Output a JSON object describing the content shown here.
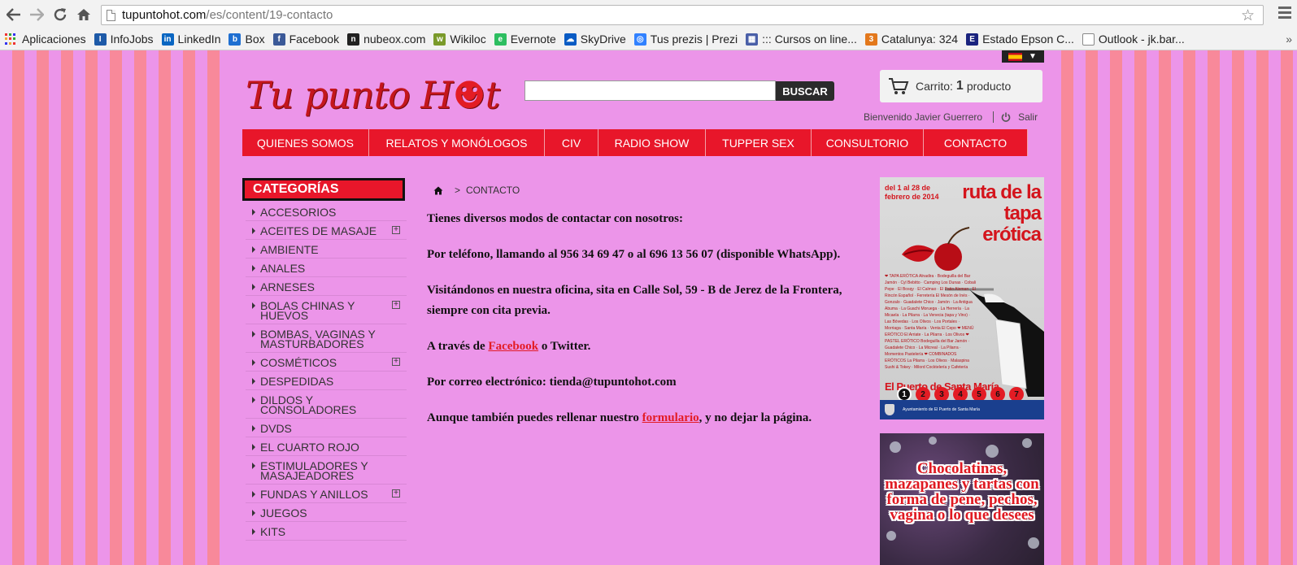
{
  "browser": {
    "url_host": "tupuntohot.com",
    "url_path": "/es/content/19-contacto",
    "bookmarks": [
      {
        "label": "Aplicaciones",
        "icon": "apps-icon"
      },
      {
        "label": "InfoJobs",
        "icon": "infojobs-icon",
        "color": "#1e5aa8",
        "glyph": "I"
      },
      {
        "label": "LinkedIn",
        "icon": "linkedin-icon",
        "color": "#0a66c2",
        "glyph": "in"
      },
      {
        "label": "Box",
        "icon": "box-icon",
        "color": "#1f6fd1",
        "glyph": "b"
      },
      {
        "label": "Facebook",
        "icon": "facebook-icon",
        "color": "#3b5998",
        "glyph": "f"
      },
      {
        "label": "nubeox.com",
        "icon": "nubeox-icon",
        "color": "#222222",
        "glyph": "n"
      },
      {
        "label": "Wikiloc",
        "icon": "wikiloc-icon",
        "color": "#7a9a2a",
        "glyph": "w"
      },
      {
        "label": "Evernote",
        "icon": "evernote-icon",
        "color": "#2dbe60",
        "glyph": "e"
      },
      {
        "label": "SkyDrive",
        "icon": "skydrive-icon",
        "color": "#0a5bc4",
        "glyph": "☁"
      },
      {
        "label": "Tus prezis | Prezi",
        "icon": "prezi-icon",
        "color": "#3181ff",
        "glyph": "◎"
      },
      {
        "label": "::: Cursos on line...",
        "icon": "cursos-icon",
        "color": "#4a5fa8",
        "glyph": "▦"
      },
      {
        "label": "Catalunya: 324",
        "icon": "catalunya-icon",
        "color": "#e3781c",
        "glyph": "3"
      },
      {
        "label": "Estado  Epson C...",
        "icon": "epson-icon",
        "color": "#1a237e",
        "glyph": "E"
      },
      {
        "label": "Outlook - jk.bar...",
        "icon": "page-icon",
        "color": "#ffffff",
        "glyph": ""
      }
    ],
    "bookmarks_more": "»"
  },
  "header": {
    "logo_text": "Tu punto H",
    "logo_devil": "☻",
    "logo_tail": "t",
    "search_placeholder": "",
    "search_button": "BUSCAR",
    "cart_label": "Carrito:",
    "cart_count": "1",
    "cart_unit": "producto",
    "welcome": "Bienvenido Javier Guerrero",
    "logout": "Salir"
  },
  "nav": [
    {
      "label": "QUIENES SOMOS",
      "width": 156
    },
    {
      "label": "RELATOS Y MONÓLOGOS",
      "width": 216
    },
    {
      "label": "CIV",
      "width": 66
    },
    {
      "label": "RADIO SHOW",
      "width": 132
    },
    {
      "label": "TUPPER SEX",
      "width": 130
    },
    {
      "label": "CONSULTORIO",
      "width": 138
    },
    {
      "label": "CONTACTO",
      "width": 128
    }
  ],
  "sidebar": {
    "title": "CATEGORÍAS",
    "items": [
      {
        "label": "ACCESORIOS",
        "expand": false
      },
      {
        "label": "ACEITES DE MASAJE",
        "expand": true
      },
      {
        "label": "AMBIENTE",
        "expand": false
      },
      {
        "label": "ANALES",
        "expand": false
      },
      {
        "label": "ARNESES",
        "expand": false
      },
      {
        "label": "BOLAS CHINAS Y HUEVOS",
        "expand": true
      },
      {
        "label": "BOMBAS, VAGINAS y MASTURBADORES",
        "expand": false
      },
      {
        "label": "COSMÉTICOS",
        "expand": true
      },
      {
        "label": "DESPEDIDAS",
        "expand": false
      },
      {
        "label": "DILDOS Y CONSOLADORES",
        "expand": false
      },
      {
        "label": "DVDs",
        "expand": false
      },
      {
        "label": "EL CUARTO ROJO",
        "expand": false
      },
      {
        "label": "ESTIMULADORES Y MASAJEADORES",
        "expand": false
      },
      {
        "label": "FUNDAS Y ANILLOS",
        "expand": true
      },
      {
        "label": "JUEGOS",
        "expand": false
      },
      {
        "label": "KITS",
        "expand": false
      }
    ]
  },
  "content": {
    "breadcrumb": "CONTACTO",
    "p1": "Tienes diversos modos de contactar con nosotros:",
    "p2": "Por teléfono, llamando al 956 34 69 47 o al 696 13 56 07 (disponible WhatsApp).",
    "p3": "Visitándonos en nuestra oficina, sita en Calle Sol, 59 - B de Jerez de la Frontera, siempre con cita previa.",
    "p4_pre": "A través de ",
    "p4_link": "Facebook",
    "p4_post": " o Twitter.",
    "p5": "Por correo electrónico: tienda@tupuntohot.com",
    "p6_pre": "Aunque también puedes rellenar nuestro ",
    "p6_link": "formulario",
    "p6_post": ", y no dejar la página."
  },
  "banner1": {
    "date": "del 1 al 28 de febrero de 2014",
    "title": "ruta de la tapa erótica",
    "body": "❤ TAPA ERÓTICA Alnadira · Bodeguilla del Bar Jamón · Cyl Bebitto · Camping Los Dunas · Cobali Pepe · El Bosqy · El Calmao · El Patio Aleman · El Rincón Español · Ferretería El Mesón de Inés · Gonzalo · Guadalete Chico · Jamón · La Antigua Abuma · La Guachi Moruega · La Herrería · La Micaela · La Pilarra · La Venecia (tapa y Vino) · Las Bóvedas · Los Olivos · Los Portales · Morriaga · Santa María · Venta El Cepo ❤ MENÚ ERÓTICO El Arriate · La Pilarra · Los Olivos ❤ PASTEL ERÓTICO Bodeguilla del Bar Jamón · Guadalete Chico · La Micreal · La Pilarra · Momentos Pastelería ❤ COMBINADOS ERÓTICOS La Pilarra · Los Olivos · Malaspina Sushi & Tokey · Milord Cocktelería y Cafetería",
    "place": "El Puerto de Santa María",
    "dots": [
      "1",
      "2",
      "3",
      "4",
      "5",
      "6",
      "7"
    ],
    "footer": "Ayuntamiento de El Puerto de Santa María"
  },
  "banner2": {
    "text": "Chocolatinas, mazapanes y tartas con forma de pene, pechos, vagina o lo que desees"
  }
}
